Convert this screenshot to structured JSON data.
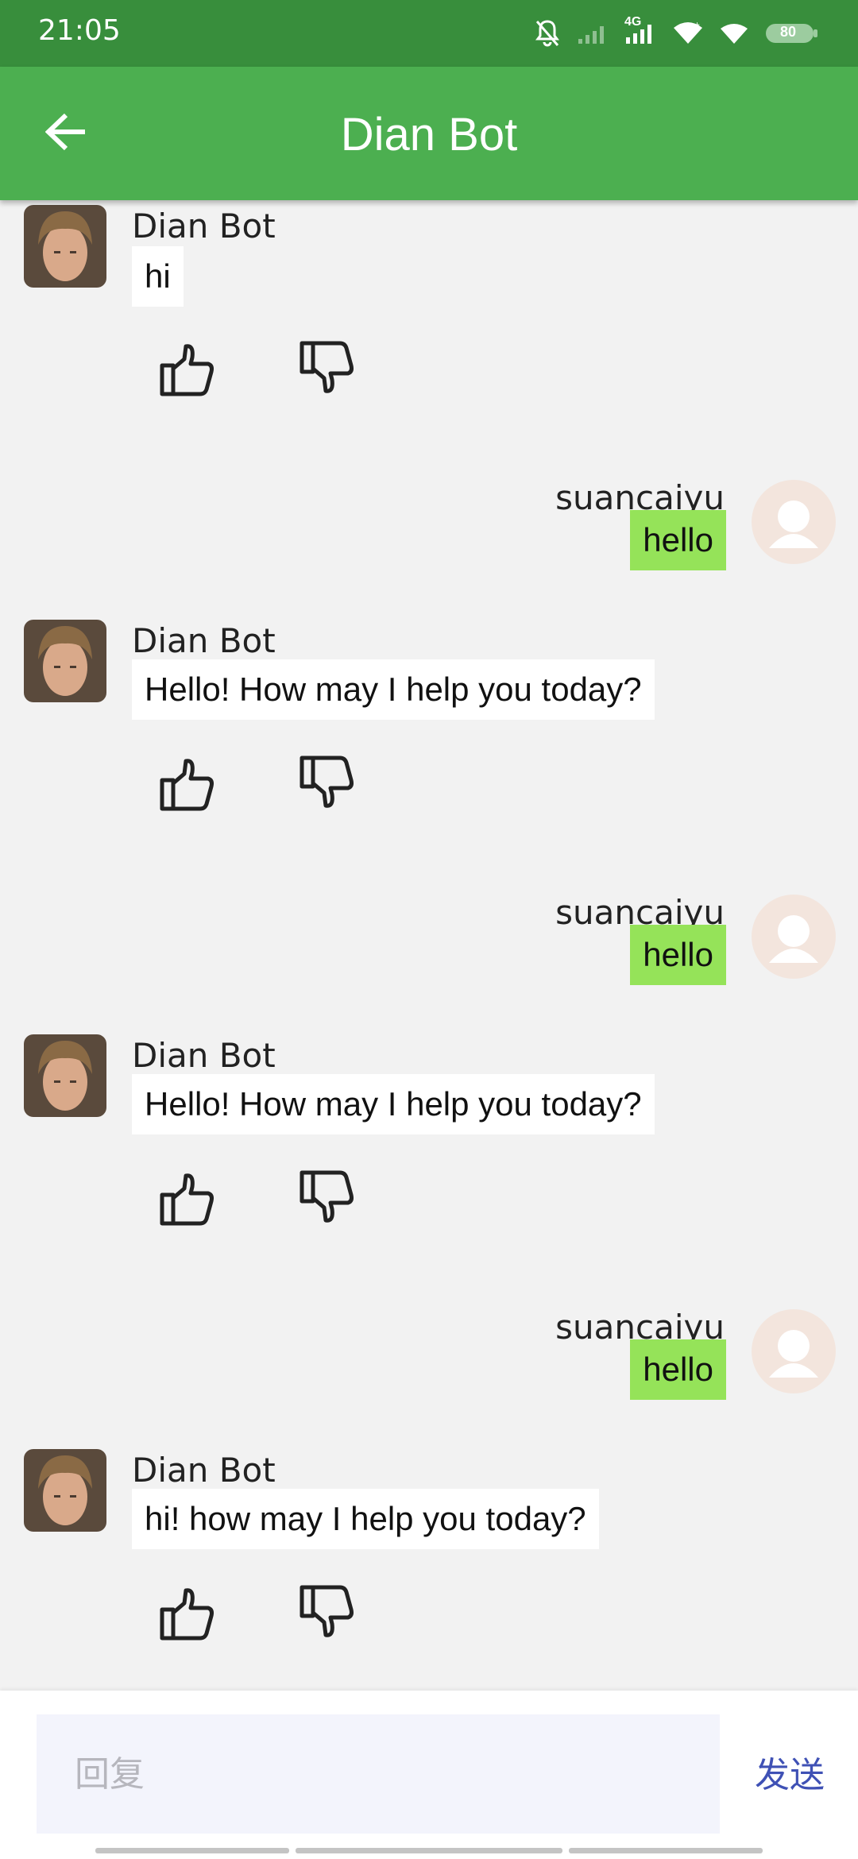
{
  "status": {
    "time": "21:05",
    "battery": "80",
    "network": "4G"
  },
  "appbar": {
    "title": "Dian Bot"
  },
  "messages": [
    {
      "role": "bot",
      "sender": "Dian Bot",
      "text": "hi"
    },
    {
      "role": "user",
      "sender": "suancaiyu",
      "text": "hello"
    },
    {
      "role": "bot",
      "sender": "Dian Bot",
      "text": "Hello! How may I help you today?"
    },
    {
      "role": "user",
      "sender": "suancaiyu",
      "text": "hello"
    },
    {
      "role": "bot",
      "sender": "Dian Bot",
      "text": "Hello! How may I help you today?"
    },
    {
      "role": "user",
      "sender": "suancaiyu",
      "text": "hello"
    },
    {
      "role": "bot",
      "sender": "Dian Bot",
      "text": "hi! how may I help you today?"
    }
  ],
  "footer": {
    "placeholder": "回复",
    "send_label": "发送"
  },
  "colors": {
    "statusbar": "#388e3c",
    "appbar": "#4caf50",
    "user_bubble": "#95e359",
    "send": "#3f51b5"
  }
}
